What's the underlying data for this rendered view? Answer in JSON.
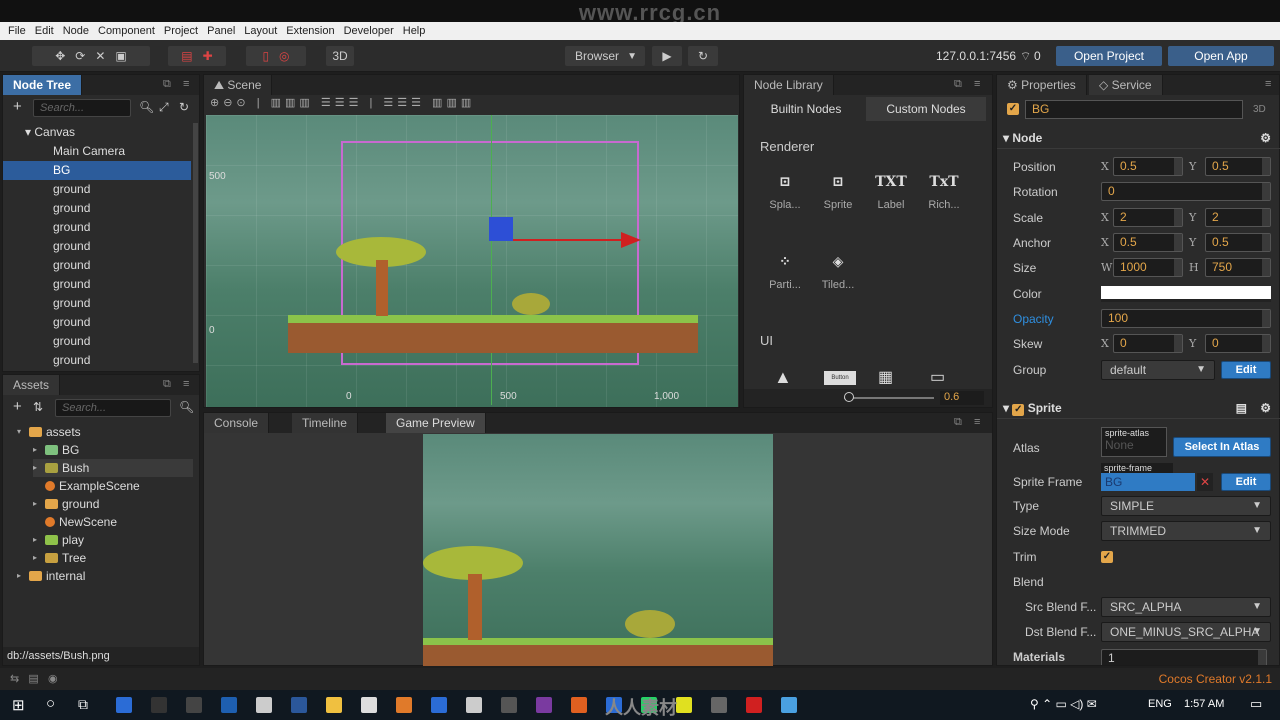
{
  "watermark": "www.rrcg.cn",
  "menu": [
    "File",
    "Edit",
    "Node",
    "Component",
    "Project",
    "Panel",
    "Layout",
    "Extension",
    "Developer",
    "Help"
  ],
  "toolbar": {
    "mode_3d": "3D",
    "platform": "Browser",
    "ip": "127.0.0.1:7456",
    "wifi_count": "0",
    "open_project": "Open Project",
    "open_app": "Open App"
  },
  "node_tree": {
    "title": "Node Tree",
    "search_placeholder": "Search...",
    "items": [
      {
        "label": "Canvas",
        "depth": 0,
        "expanded": true
      },
      {
        "label": "Main Camera",
        "depth": 1
      },
      {
        "label": "BG",
        "depth": 1,
        "selected": true
      },
      {
        "label": "ground",
        "depth": 1
      },
      {
        "label": "ground",
        "depth": 1
      },
      {
        "label": "ground",
        "depth": 1
      },
      {
        "label": "ground",
        "depth": 1
      },
      {
        "label": "ground",
        "depth": 1
      },
      {
        "label": "ground",
        "depth": 1
      },
      {
        "label": "ground",
        "depth": 1
      },
      {
        "label": "ground",
        "depth": 1
      },
      {
        "label": "ground",
        "depth": 1
      },
      {
        "label": "ground",
        "depth": 1
      }
    ]
  },
  "assets": {
    "title": "Assets",
    "search_placeholder": "Search...",
    "items": [
      {
        "label": "assets",
        "depth": 0,
        "icon": "folder-icon",
        "color": "#e3a64a"
      },
      {
        "label": "BG",
        "depth": 1,
        "icon": "image-icon",
        "color": "#7ec17e"
      },
      {
        "label": "Bush",
        "depth": 1,
        "icon": "image-icon",
        "color": "#a8a040",
        "selected": true
      },
      {
        "label": "ExampleScene",
        "depth": 1,
        "icon": "scene-icon",
        "color": "#e07a2a"
      },
      {
        "label": "ground",
        "depth": 1,
        "icon": "folder-icon",
        "color": "#e3a64a"
      },
      {
        "label": "NewScene",
        "depth": 1,
        "icon": "scene-icon",
        "color": "#e07a2a"
      },
      {
        "label": "play",
        "depth": 1,
        "icon": "image-icon",
        "color": "#8fc24a"
      },
      {
        "label": "Tree",
        "depth": 1,
        "icon": "image-icon",
        "color": "#c7a040"
      },
      {
        "label": "internal",
        "depth": 0,
        "icon": "folder-icon",
        "color": "#e3a64a"
      }
    ],
    "status_path": "db://assets/Bush.png"
  },
  "scene": {
    "title": "Scene",
    "ruler_y": [
      "500",
      "0"
    ],
    "ruler_x": [
      "0",
      "500",
      "1,000"
    ]
  },
  "node_library": {
    "title": "Node Library",
    "tabs": [
      "Builtin Nodes",
      "Custom Nodes"
    ],
    "renderer_label": "Renderer",
    "renderer": [
      {
        "label": "Spla...",
        "icon": "sprite-splash-icon"
      },
      {
        "label": "Sprite",
        "icon": "sprite-icon"
      },
      {
        "label": "Label",
        "glyph": "TXT"
      },
      {
        "label": "Rich...",
        "glyph": "TxT"
      },
      {
        "label": "Parti...",
        "icon": "particle-icon"
      },
      {
        "label": "Tiled...",
        "icon": "tiled-icon"
      }
    ],
    "ui_label": "UI",
    "ui_button_text": "Button",
    "zoom_value": "0.6"
  },
  "bottom": {
    "tabs": [
      "Console",
      "Timeline",
      "Game Preview"
    ],
    "active": "Game Preview"
  },
  "properties": {
    "tabs": [
      "Properties",
      "Service"
    ],
    "node_name": "BG",
    "tag_3d": "3D",
    "node_section": "Node",
    "position": {
      "label": "Position",
      "x": "0.5",
      "y": "0.5"
    },
    "rotation": {
      "label": "Rotation",
      "value": "0"
    },
    "scale": {
      "label": "Scale",
      "x": "2",
      "y": "2"
    },
    "anchor": {
      "label": "Anchor",
      "x": "0.5",
      "y": "0.5"
    },
    "size": {
      "label": "Size",
      "w": "1000",
      "h": "750"
    },
    "color": {
      "label": "Color",
      "value": "#ffffff"
    },
    "opacity": {
      "label": "Opacity",
      "value": "100"
    },
    "skew": {
      "label": "Skew",
      "x": "0",
      "y": "0"
    },
    "group": {
      "label": "Group",
      "value": "default",
      "edit": "Edit"
    },
    "sprite_section": "Sprite",
    "atlas": {
      "label": "Atlas",
      "tag": "sprite-atlas",
      "value": "None",
      "button": "Select In Atlas"
    },
    "sprite_frame": {
      "label": "Sprite Frame",
      "tag": "sprite-frame",
      "value": "BG",
      "edit": "Edit"
    },
    "type": {
      "label": "Type",
      "value": "SIMPLE"
    },
    "size_mode": {
      "label": "Size Mode",
      "value": "TRIMMED"
    },
    "trim": {
      "label": "Trim",
      "checked": true
    },
    "blend": {
      "label": "Blend"
    },
    "src_blend": {
      "label": "Src Blend F...",
      "value": "SRC_ALPHA"
    },
    "dst_blend": {
      "label": "Dst Blend F...",
      "value": "ONE_MINUS_SRC_ALPHA"
    },
    "materials": {
      "label": "Materials",
      "value": "1"
    }
  },
  "status": {
    "version": "Cocos Creator v2.1.1"
  },
  "taskbar": {
    "lang": "ENG",
    "time": "1:57 AM",
    "watermark": "人人素材"
  },
  "colors": {
    "accent": "#2f7bc4",
    "value": "#e3a64a",
    "version": "#e07a2a"
  }
}
